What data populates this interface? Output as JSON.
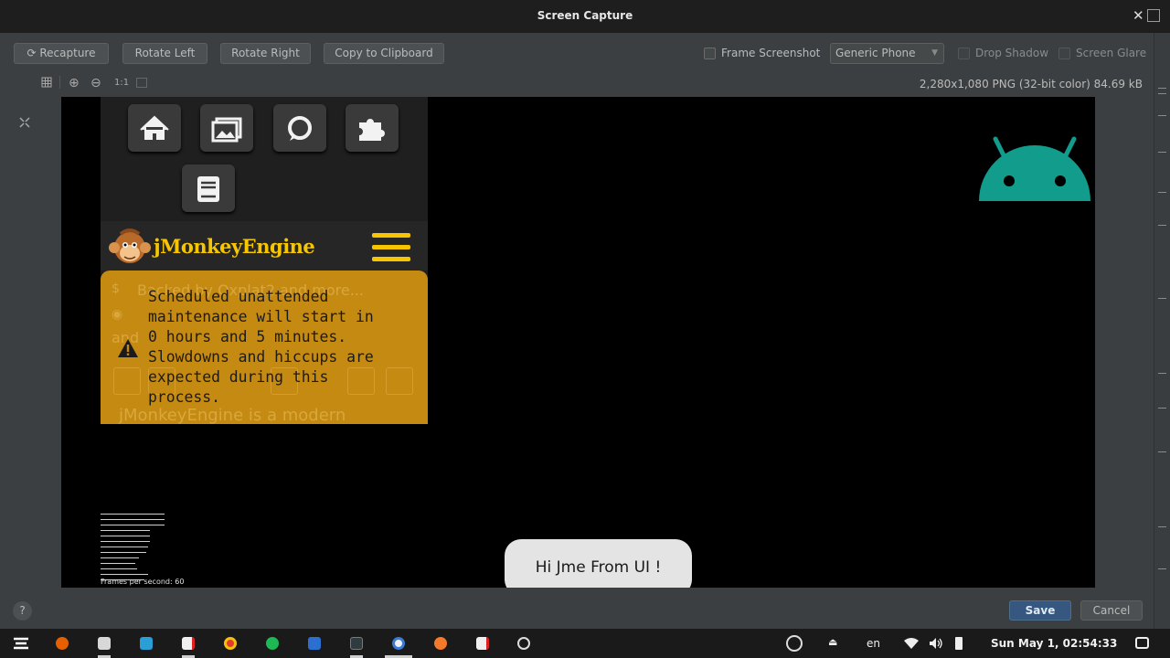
{
  "window": {
    "title": "Screen Capture",
    "close_glyph": "✕"
  },
  "toolbar": {
    "recapture_label": "Recapture",
    "rotate_left_label": "Rotate Left",
    "rotate_right_label": "Rotate Right",
    "copy_label": "Copy to Clipboard",
    "frame_screenshot_label": "Frame Screenshot",
    "frame_screenshot_checked": false,
    "device_selected": "Generic Phone",
    "drop_shadow_label": "Drop Shadow",
    "drop_shadow_checked": false,
    "screen_glare_label": "Screen Glare",
    "screen_glare_checked": false
  },
  "view_controls": {
    "fit_icon": "fit-screen-icon",
    "grid_icon": "grid-icon",
    "zoom_in_glyph": "⊕",
    "zoom_out_glyph": "⊖",
    "actual_size_label": "1:1",
    "image_info": "2,280x1,080 PNG (32-bit color) 84.69 kB"
  },
  "screenshot": {
    "nav_icons": [
      "home-icon",
      "gallery-icon",
      "chat-icon",
      "puzzle-icon",
      "book-icon"
    ],
    "site_title": "jMonkeyEngine",
    "banner_ghost_1": "Backed by Oxplat2 and more...",
    "banner_ghost_3": "and",
    "banner_ghost_4": "jMonkeyEngine is a modern",
    "notice_text": "Scheduled unattended\nmaintenance will start in\n0 hours and 5 minutes.\nSlowdowns and hiccups are\nexpected during this\nprocess.",
    "fps_label": "Frames per second: 60",
    "toast_text": "Hi Jme From UI !",
    "colors": {
      "banner": "#c58a12",
      "logo_yellow": "#f7c600",
      "android_green": "#119c8c"
    }
  },
  "footer": {
    "help_glyph": "?",
    "save_label": "Save",
    "cancel_label": "Cancel"
  },
  "taskbar": {
    "apps": [
      "zorin-menu-icon",
      "firefox-icon",
      "files-icon",
      "screenshot-icon",
      "pdf-icon",
      "chrome-icon",
      "spotify-icon",
      "writer-icon",
      "terminal-icon",
      "android-studio-icon",
      "blender-icon",
      "pdf-viewer-icon",
      "obs-icon"
    ],
    "language": "en",
    "clock": "Sun May  1, 02:54:33"
  }
}
